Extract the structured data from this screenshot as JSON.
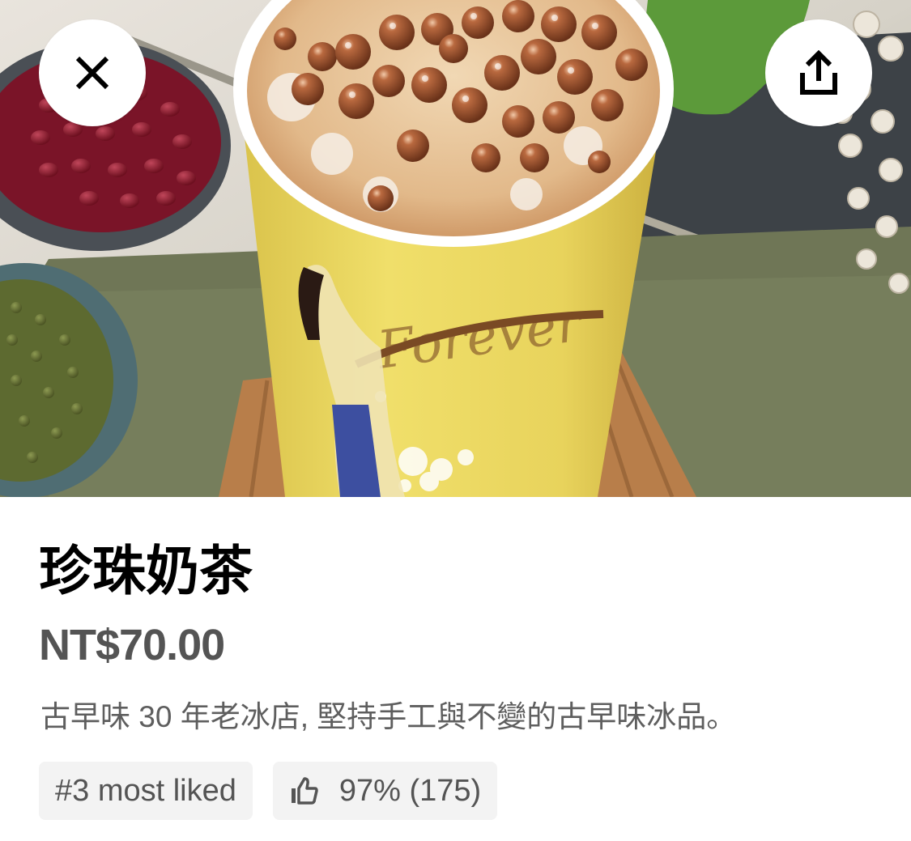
{
  "hero": {
    "close_icon": "close-icon",
    "share_icon": "share-icon"
  },
  "item": {
    "name": "珍珠奶茶",
    "price": "NT$70.00",
    "description": "古早味 30 年老冰店, 堅持手工與不變的古早味冰品。"
  },
  "badges": {
    "rank_label": "#3 most liked",
    "rating_icon": "thumbs-up-icon",
    "rating_label": "97% (175)"
  }
}
